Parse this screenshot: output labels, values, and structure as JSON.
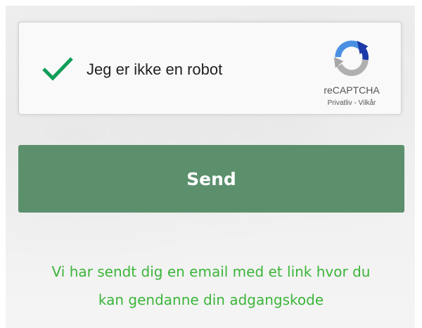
{
  "recaptcha": {
    "label": "Jeg er ikke en robot",
    "brand": "reCAPTCHA",
    "privacy_link": "Privatliv",
    "separator": " - ",
    "terms_link": "Vilkår",
    "checked": true,
    "check_icon": "checkmark-icon",
    "logo_icon": "recaptcha-logo-icon",
    "check_color": "#109d58"
  },
  "form": {
    "send_label": "Send",
    "button_color": "#5c906d"
  },
  "message": {
    "line1": "Vi har sendt dig en email med et link hvor du",
    "line2": "kan gendanne din adgangskode",
    "color": "#3cb53a"
  }
}
